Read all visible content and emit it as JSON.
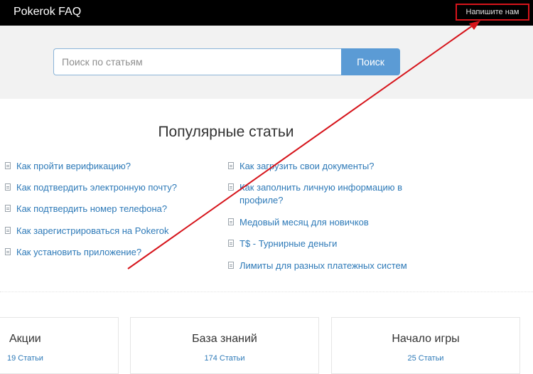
{
  "header": {
    "brand": "Pokerok FAQ",
    "contact_label": "Напишите нам"
  },
  "search": {
    "placeholder": "Поиск по статьям",
    "button_label": "Поиск"
  },
  "popular": {
    "title": "Популярные статьи",
    "left": [
      "Как пройти верификацию?",
      "Как подтвердить электронную почту?",
      "Как подтвердить номер телефона?",
      "Как зарегистрироваться на Pokerok",
      "Как установить приложение?"
    ],
    "right": [
      "Как загрузить свои документы?",
      "Как заполнить личную информацию в профиле?",
      "Медовый месяц для новичков",
      "T$ - Турнирные деньги",
      "Лимиты для разных платежных систем"
    ]
  },
  "categories": [
    {
      "title": "Акции",
      "count": "19 Статьи"
    },
    {
      "title": "База знаний",
      "count": "174 Статьи"
    },
    {
      "title": "Начало игры",
      "count": "25 Статьи"
    }
  ],
  "colors": {
    "accent": "#5b9bd5",
    "link": "#2e7ab8",
    "annotation": "#d6141b",
    "topbar": "#000000"
  }
}
